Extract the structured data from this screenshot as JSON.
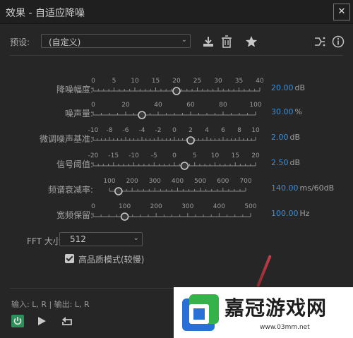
{
  "window": {
    "title": "效果 - 自适应降噪",
    "close_glyph": "✕"
  },
  "preset": {
    "label": "预设:",
    "value": "(自定义)"
  },
  "toolbar": {
    "icons": [
      "download-icon",
      "trash-icon",
      "star-icon",
      "route-icon",
      "info-icon"
    ]
  },
  "sliders": [
    {
      "label": "降噪幅度:",
      "ticks": [
        "0",
        "5",
        "10",
        "15",
        "20",
        "25",
        "30",
        "35",
        "40"
      ],
      "min": 0,
      "max": 40,
      "value": 20,
      "value_text": "20.00",
      "unit": "dB"
    },
    {
      "label": "噪声量:",
      "ticks": [
        "0",
        "20",
        "40",
        "60",
        "80",
        "100"
      ],
      "min": 0,
      "max": 100,
      "value": 30,
      "value_text": "30.00",
      "unit": "%"
    },
    {
      "label": "微调噪声基准:",
      "ticks": [
        "-10",
        "-8",
        "-6",
        "-4",
        "-2",
        "0",
        "2",
        "4",
        "6",
        "8",
        "10"
      ],
      "min": -10,
      "max": 10,
      "value": 2,
      "value_text": "2.00",
      "unit": "dB"
    },
    {
      "label": "信号阈值:",
      "ticks": [
        "-20",
        "-15",
        "-10",
        "-5",
        "0",
        "5",
        "10",
        "15",
        "20"
      ],
      "min": -20,
      "max": 20,
      "value": 2.5,
      "value_text": "2.50",
      "unit": "dB"
    },
    {
      "label": "频谱衰减率:",
      "ticks": [
        "100",
        "200",
        "300",
        "400",
        "500",
        "600",
        "700"
      ],
      "min": 100,
      "max": 700,
      "value": 140,
      "value_text": "140.00",
      "unit": "ms/60dB"
    },
    {
      "label": "宽频保留:",
      "ticks": [
        "0",
        "100",
        "200",
        "300",
        "400",
        "500"
      ],
      "min": 0,
      "max": 500,
      "value": 100,
      "value_text": "100.00",
      "unit": "Hz"
    }
  ],
  "fft": {
    "label": "FFT 大小:",
    "value": "512"
  },
  "high_quality": {
    "label": "高品质模式(较慢)",
    "checked": true
  },
  "io": {
    "text": "输入: L, R | 输出: L, R"
  },
  "watermark": {
    "brand": "嘉冠游戏网",
    "url": "www.03mm.net"
  },
  "colors": {
    "accent": "#3e8fd8",
    "background": "#262626",
    "power_green": "#2f8f5a"
  }
}
